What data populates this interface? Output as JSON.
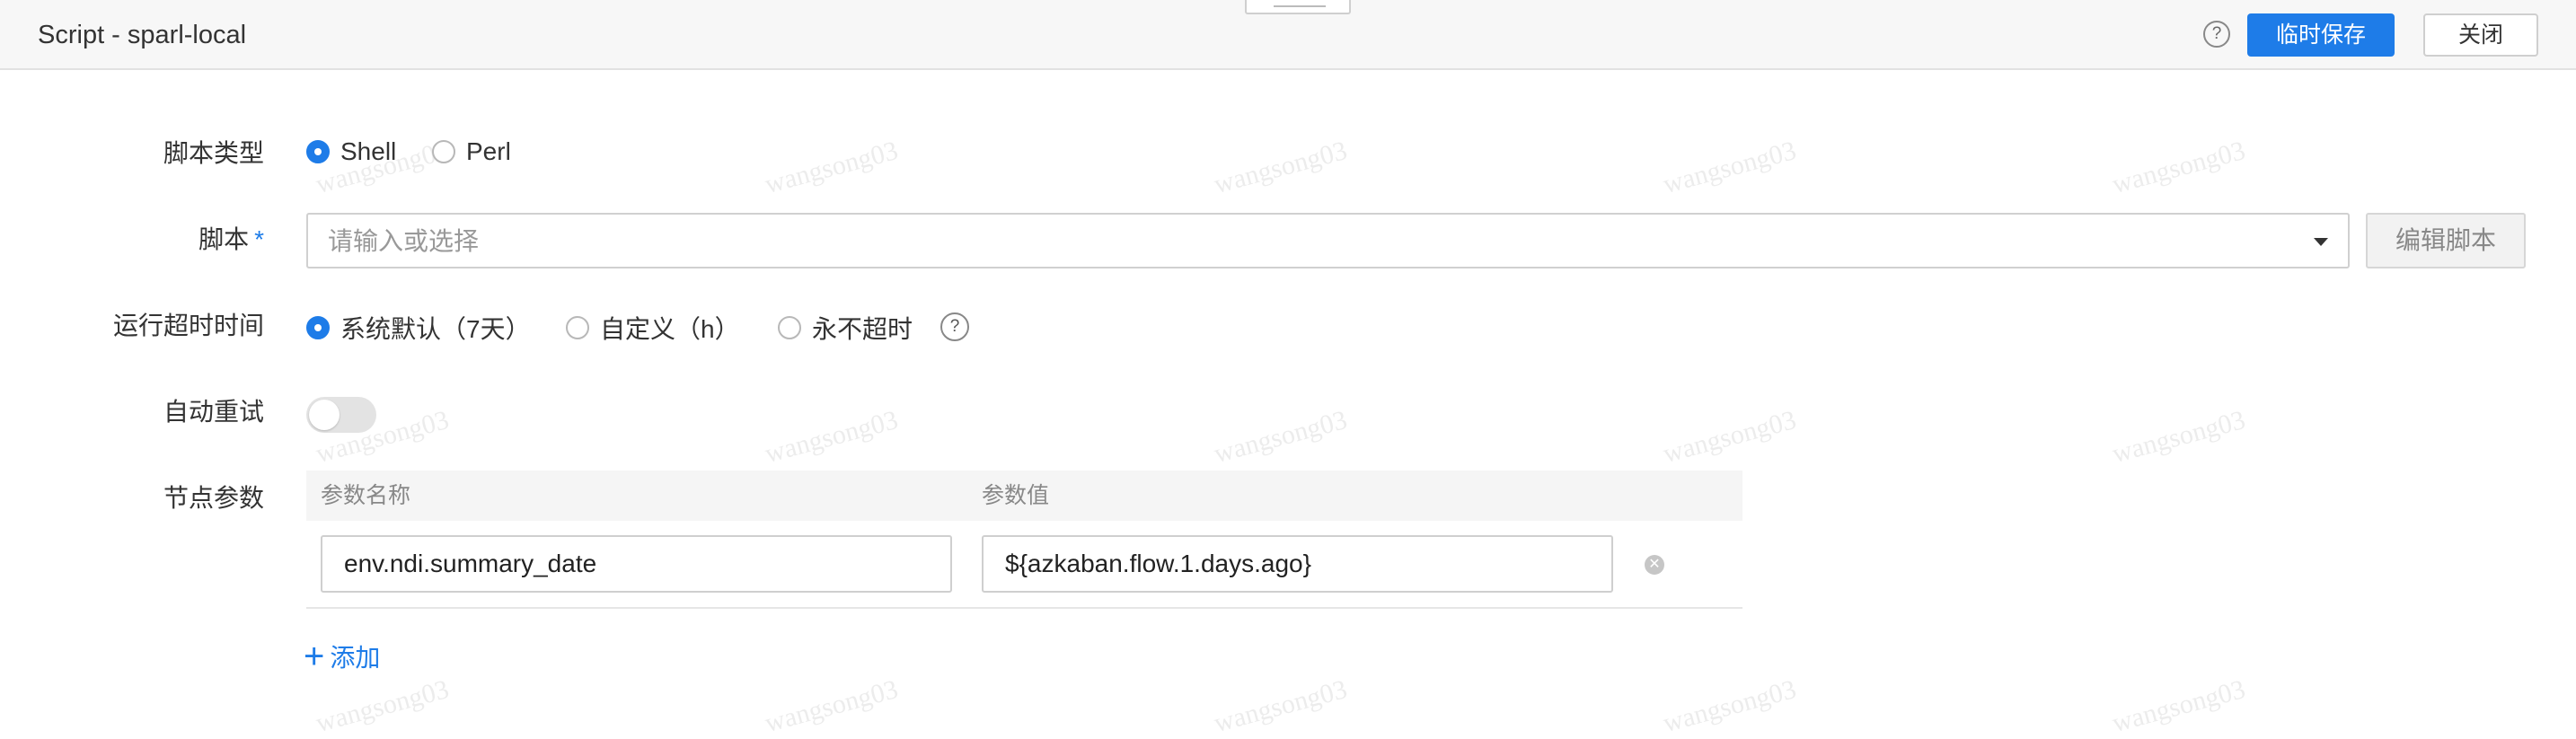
{
  "header": {
    "title": "Script - sparl-local",
    "help": "?",
    "temp_save": "临时保存",
    "close": "关闭"
  },
  "form": {
    "script_type": {
      "label": "脚本类型",
      "options": [
        "Shell",
        "Perl"
      ],
      "selected": "Shell"
    },
    "script": {
      "label": "脚本",
      "required_mark": "*",
      "placeholder": "请输入或选择",
      "edit_button": "编辑脚本"
    },
    "timeout": {
      "label": "运行超时时间",
      "options": [
        "系统默认（7天）",
        "自定义（h）",
        "永不超时"
      ],
      "selected": "系统默认（7天）",
      "help": "?"
    },
    "auto_retry": {
      "label": "自动重试",
      "enabled": false
    },
    "node_params": {
      "label": "节点参数",
      "headers": [
        "参数名称",
        "参数值"
      ],
      "rows": [
        {
          "name": "env.ndi.summary_date",
          "value": "${azkaban.flow.1.days.ago}"
        }
      ],
      "add_label": "添加"
    }
  },
  "watermark": "wangsong03",
  "colors": {
    "accent": "#1e7ce8",
    "header_bg": "#f7f7f7"
  }
}
